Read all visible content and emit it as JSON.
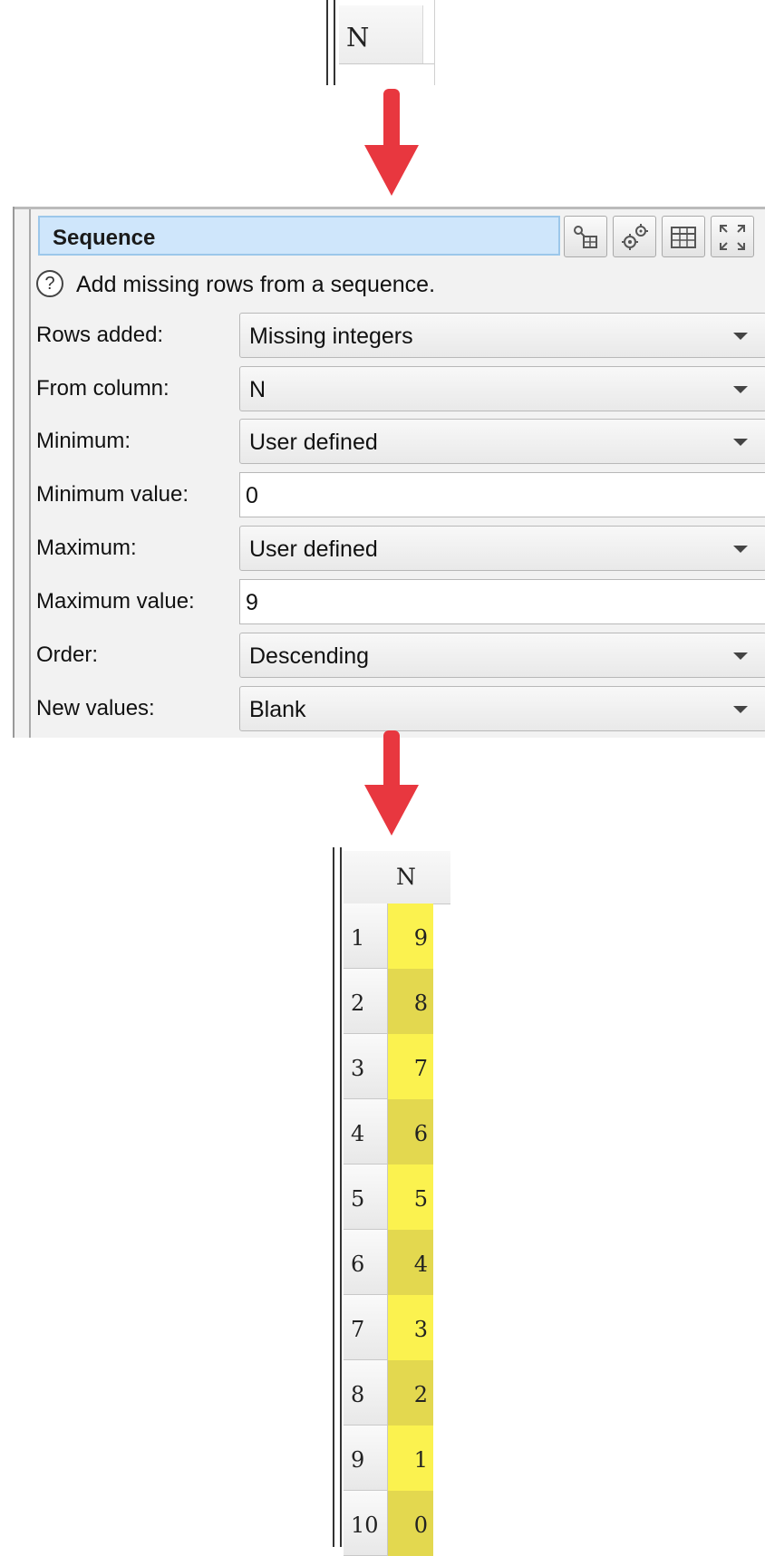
{
  "input_column": {
    "header": "N"
  },
  "dialog": {
    "title": "Sequence",
    "help_text": "Add missing rows from a sequence.",
    "help_icon": "?",
    "fields": [
      {
        "label": "Rows added:",
        "type": "dropdown",
        "value": "Missing integers"
      },
      {
        "label": "From column:",
        "type": "dropdown",
        "value": "N"
      },
      {
        "label": "Minimum:",
        "type": "dropdown",
        "value": "User defined"
      },
      {
        "label": "Minimum value:",
        "type": "text",
        "value": "0"
      },
      {
        "label": "Maximum:",
        "type": "dropdown",
        "value": "User defined"
      },
      {
        "label": "Maximum value:",
        "type": "text",
        "value": "9"
      },
      {
        "label": "Order:",
        "type": "dropdown",
        "value": "Descending"
      },
      {
        "label": "New values:",
        "type": "dropdown",
        "value": "Blank"
      }
    ],
    "toolbar_icons": [
      "link-table-icon",
      "gear-icon",
      "table-icon",
      "expand-icon"
    ]
  },
  "output_table": {
    "header": "N",
    "rows": [
      {
        "index": "1",
        "value": "9"
      },
      {
        "index": "2",
        "value": "8"
      },
      {
        "index": "3",
        "value": "7"
      },
      {
        "index": "4",
        "value": "6"
      },
      {
        "index": "5",
        "value": "5"
      },
      {
        "index": "6",
        "value": "4"
      },
      {
        "index": "7",
        "value": "3"
      },
      {
        "index": "8",
        "value": "2"
      },
      {
        "index": "9",
        "value": "1"
      },
      {
        "index": "10",
        "value": "0"
      }
    ]
  },
  "colors": {
    "arrow": "#e8373f",
    "highlight_light": "#fbf24f",
    "highlight_dark": "#e3d84f",
    "title_bg": "#cfe6fb"
  }
}
